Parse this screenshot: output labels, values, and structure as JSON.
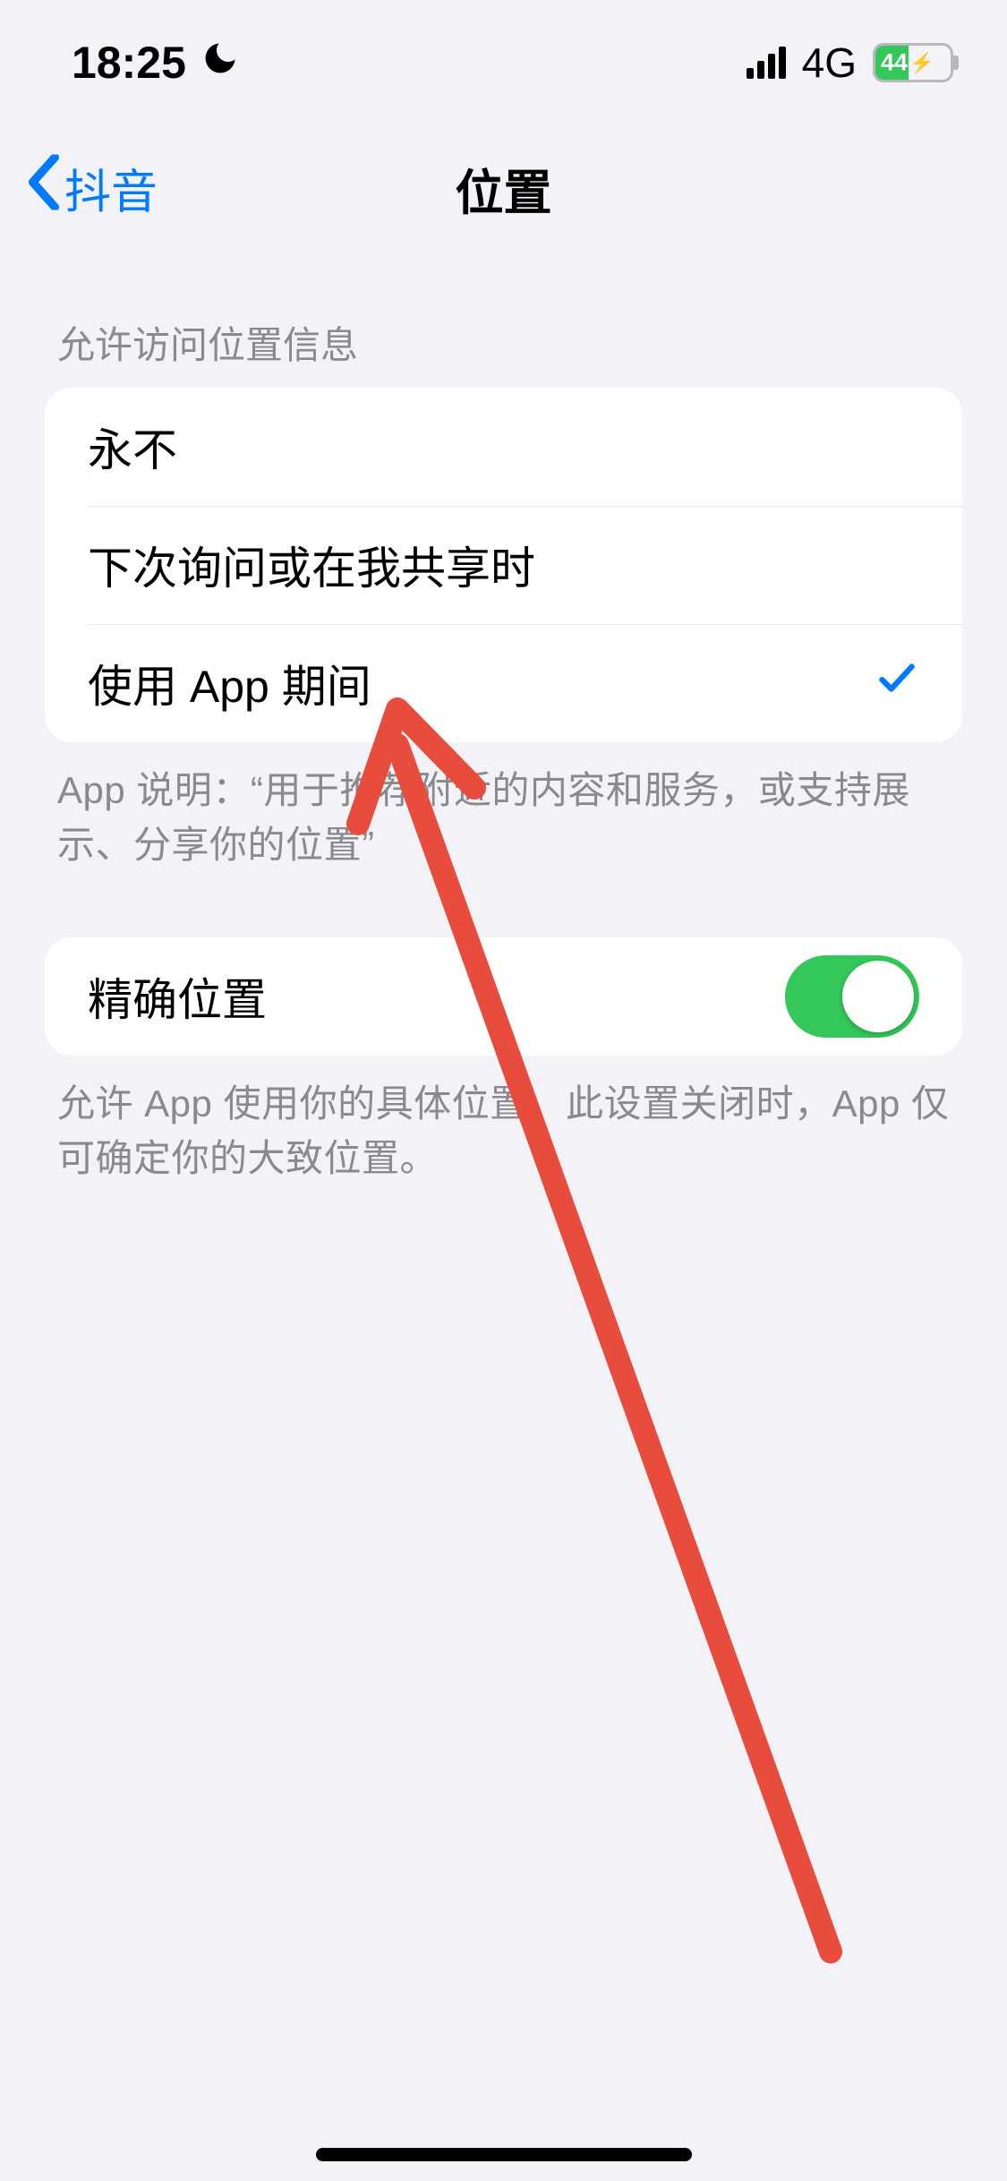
{
  "status": {
    "time": "18:25",
    "network": "4G",
    "battery_text": "44"
  },
  "nav": {
    "back_label": "抖音",
    "title": "位置"
  },
  "section1": {
    "header": "允许访问位置信息",
    "options": [
      {
        "label": "永不",
        "selected": false
      },
      {
        "label": "下次询问或在我共享时",
        "selected": false
      },
      {
        "label": "使用 App 期间",
        "selected": true
      }
    ],
    "footer": "App 说明：“用于推荐附近的内容和服务，或支持展示、分享你的位置”"
  },
  "section2": {
    "toggle_label": "精确位置",
    "toggle_on": true,
    "footer": "允许 App 使用你的具体位置。此设置关闭时，App 仅可确定你的大致位置。"
  },
  "annotation": {
    "type": "arrow",
    "color": "#e74c3c"
  }
}
